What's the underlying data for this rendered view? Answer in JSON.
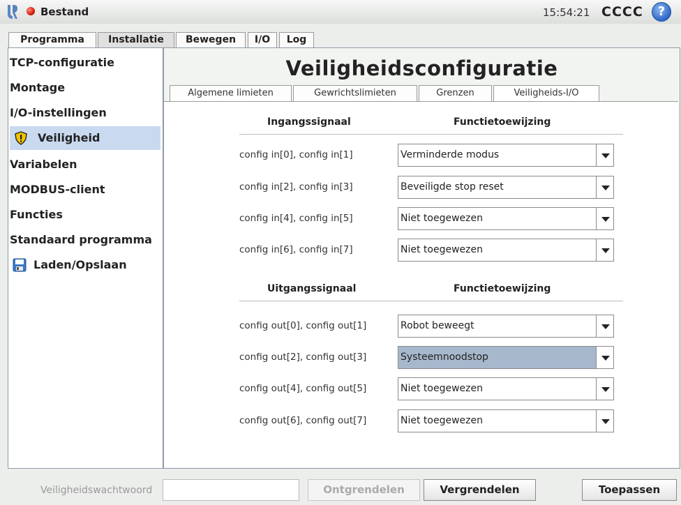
{
  "header": {
    "app_title": "Bestand",
    "clock": "15:54:21",
    "robot_name": "CCCC",
    "help": "?"
  },
  "main_tabs": [
    "Programma",
    "Installatie",
    "Bewegen",
    "I/O",
    "Log"
  ],
  "sidebar": {
    "items": [
      {
        "label": "TCP-configuratie"
      },
      {
        "label": "Montage"
      },
      {
        "label": "I/O-instellingen"
      },
      {
        "label": "Veiligheid",
        "icon": "warning-shield-icon",
        "selected": true
      },
      {
        "label": "Variabelen"
      },
      {
        "label": "MODBUS-client"
      },
      {
        "label": "Functies"
      },
      {
        "label": "Standaard programma"
      },
      {
        "label": "Laden/Opslaan",
        "icon": "save-disk-icon"
      }
    ]
  },
  "main": {
    "title": "Veiligheidsconfiguratie",
    "tabs": [
      "Algemene limieten",
      "Gewrichtslimieten",
      "Grenzen",
      "Veiligheids-I/O"
    ],
    "inputs": {
      "col1": "Ingangssignaal",
      "col2": "Functietoewijzing",
      "rows": [
        {
          "label": "config in[0], config in[1]",
          "value": "Verminderde modus"
        },
        {
          "label": "config in[2], config in[3]",
          "value": "Beveiligde stop reset"
        },
        {
          "label": "config in[4], config in[5]",
          "value": "Niet toegewezen"
        },
        {
          "label": "config in[6], config in[7]",
          "value": "Niet toegewezen"
        }
      ]
    },
    "outputs": {
      "col1": "Uitgangssignaal",
      "col2": "Functietoewijzing",
      "rows": [
        {
          "label": "config out[0], config out[1]",
          "value": "Robot beweegt"
        },
        {
          "label": "config out[2], config out[3]",
          "value": "Systeemnoodstop",
          "highlighted": true
        },
        {
          "label": "config out[4], config out[5]",
          "value": "Niet toegewezen"
        },
        {
          "label": "config out[6], config out[7]",
          "value": "Niet toegewezen"
        }
      ]
    }
  },
  "footer": {
    "password_label": "Veiligheidswachtwoord",
    "password_value": "",
    "unlock": "Ontgrendelen",
    "lock": "Vergrendelen",
    "apply": "Toepassen"
  },
  "colors": {
    "selected_sidebar": "#c9d9f0",
    "highlighted_dropdown": "#a7b8cc",
    "status_dot": "#d21a0a",
    "help_icon": "#2d68c7"
  }
}
